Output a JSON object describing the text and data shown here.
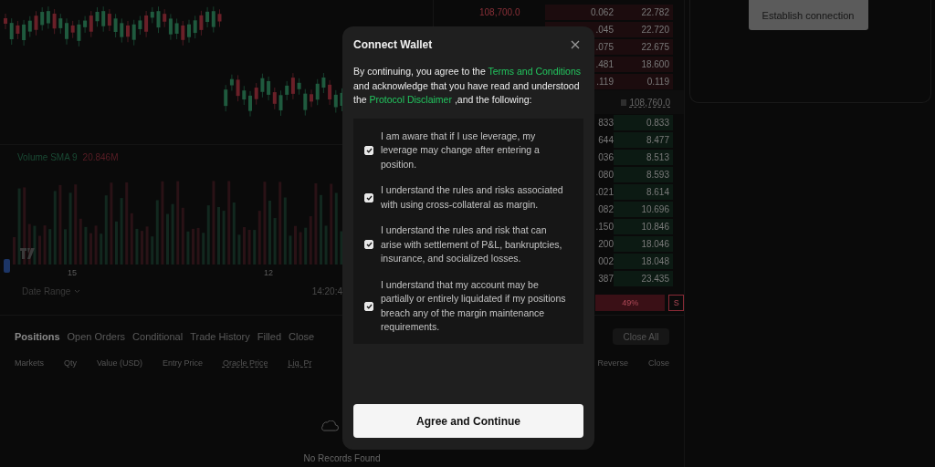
{
  "chart": {
    "indicator_label": "Volume SMA 9",
    "indicator_value": "20.846M",
    "time_labels": [
      "15",
      "12"
    ],
    "date_range": "Date Range",
    "clock": "14:20:4"
  },
  "order_book": {
    "asks": [
      {
        "price": "108,700.0",
        "size": "0.062",
        "total": "22.782"
      },
      {
        "size": ".045",
        "total": "22.720"
      },
      {
        "size": ".075",
        "total": "22.675"
      },
      {
        "size": ".481",
        "total": "18.600"
      },
      {
        "size": ".119",
        "total": "0.119"
      }
    ],
    "mid_price": "108,760.0",
    "bids": [
      {
        "size": "833",
        "total": "0.833"
      },
      {
        "size": "644",
        "total": "8.477"
      },
      {
        "size": "036",
        "total": "8.513"
      },
      {
        "size": "080",
        "total": "8.593"
      },
      {
        "size": ".021",
        "total": "8.614"
      },
      {
        "size": "082",
        "total": "10.696"
      },
      {
        "size": ".150",
        "total": "10.846"
      },
      {
        "size": "200",
        "total": "18.046"
      },
      {
        "size": "002",
        "total": "18.048"
      },
      {
        "size": "387",
        "total": "23.435"
      }
    ],
    "ratio": "49%",
    "side": "S"
  },
  "connection_button": "Establish connection",
  "tabs": [
    {
      "label": "Positions",
      "selected": true
    },
    {
      "label": "Open Orders",
      "selected": false
    },
    {
      "label": "Conditional",
      "selected": false
    },
    {
      "label": "Trade History",
      "selected": false
    },
    {
      "label": "Filled",
      "selected": false
    },
    {
      "label": "Close",
      "selected": false
    }
  ],
  "close_all": "Close All",
  "columns": [
    "Markets",
    "Qty",
    "Value (USD)",
    "Entry Price",
    "Oracle Price",
    "Liq. Pr"
  ],
  "columns_right": [
    "Reverse",
    "Close"
  ],
  "empty_text": "No Records Found",
  "modal": {
    "title": "Connect Wallet",
    "intro_before": "By continuing, you agree to the ",
    "terms_link": "Terms and Conditions",
    "intro_middle": " and acknowledge that you have read and understood the ",
    "disclaimer_link": "Protocol Disclaimer",
    "intro_after": " ,and the following:",
    "items": [
      {
        "text": "I am aware that if I use leverage, my leverage may change after entering a position.",
        "checked": true
      },
      {
        "text": "I understand the rules and risks associated with using cross-collateral as margin.",
        "checked": true
      },
      {
        "text": "I understand the rules and risk that can arise with settlement of P&L, bankruptcies, insurance, and socialized losses.",
        "checked": true
      },
      {
        "text": "I understand that my account may be partially or entirely liquidated if my positions breach any of the margin maintenance requirements.",
        "checked": true
      }
    ],
    "button": "Agree and Continue"
  }
}
